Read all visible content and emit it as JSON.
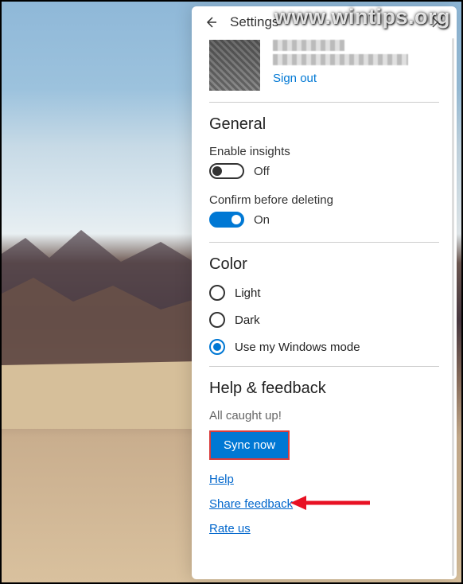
{
  "watermark": "www.wintips.org",
  "header": {
    "title": "Settings"
  },
  "profile": {
    "signout_label": "Sign out"
  },
  "sections": {
    "general": {
      "title": "General",
      "enable_insights_label": "Enable insights",
      "enable_insights_state": "Off",
      "confirm_delete_label": "Confirm before deleting",
      "confirm_delete_state": "On"
    },
    "color": {
      "title": "Color",
      "options": {
        "light": "Light",
        "dark": "Dark",
        "windows": "Use my Windows mode"
      },
      "selected": "windows"
    },
    "help": {
      "title": "Help & feedback",
      "status_caption": "All caught up!",
      "sync_button": "Sync now",
      "links": {
        "help": "Help",
        "share_feedback": "Share feedback",
        "rate_us": "Rate us"
      }
    }
  }
}
